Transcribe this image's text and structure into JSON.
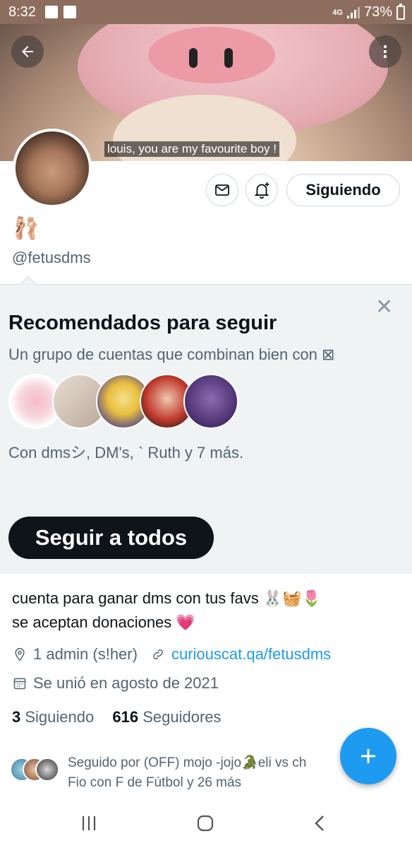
{
  "status_bar": {
    "time": "8:32",
    "network": "4G",
    "battery": "73%"
  },
  "banner": {
    "caption": "louis, you are my favourite boy !"
  },
  "profile": {
    "name_emoji": "🩰",
    "handle": "@fetusdms",
    "following_label": "Siguiendo"
  },
  "recommendations": {
    "title": "Recomendados para seguir",
    "subtitle": "Un grupo de cuentas que combinan bien con ⊠",
    "members": "Con dmsシ, DM's, ` Ruth y 7 más.",
    "follow_all": "Seguir a todos"
  },
  "bio": {
    "line1": "cuenta para ganar dms con tus favs 🐰🧺🌷",
    "line2": "se aceptan donaciones 💗",
    "location": "1 admin (s!her)",
    "link": "curiouscat.qa/fetusdms",
    "joined": "Se unió en agosto de 2021"
  },
  "stats": {
    "following_count": "3",
    "following_label": "Siguiendo",
    "followers_count": "616",
    "followers_label": "Seguidores"
  },
  "followed_by": {
    "line1": "Seguido por (OFF) mojo -jojo🐊eli vs ch",
    "line2": "Fio con F de Fútbol y 26 más"
  },
  "icons": {
    "back": "arrow-left-icon",
    "more": "more-vertical-icon",
    "message": "envelope-icon",
    "notify": "bell-plus-icon",
    "close": "close-icon",
    "location": "location-pin-icon",
    "link": "link-icon",
    "calendar": "calendar-icon",
    "compose": "plus-icon"
  },
  "colors": {
    "accent": "#1d9bf0",
    "status_bar": "#8d6e5e",
    "panel": "#eff3f4"
  }
}
